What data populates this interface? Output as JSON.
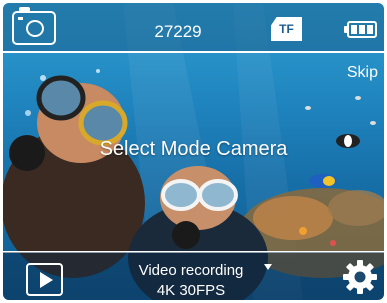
{
  "status_bar": {
    "photo_icon": "photo-camera-icon",
    "shot_count": "27229",
    "storage_label": "TF",
    "battery_icon": "battery-full-icon"
  },
  "skip_label": "Skip",
  "mode_prompt": "Select Mode Camera",
  "bottom_bar": {
    "play_icon": "play-icon",
    "mode_name": "Video recording",
    "mode_resolution": "4K 30FPS",
    "settings_icon": "gear-icon"
  },
  "colors": {
    "water_top": "#2f9fd2",
    "water_bottom": "#0f5a8f",
    "text": "#ffffff"
  }
}
